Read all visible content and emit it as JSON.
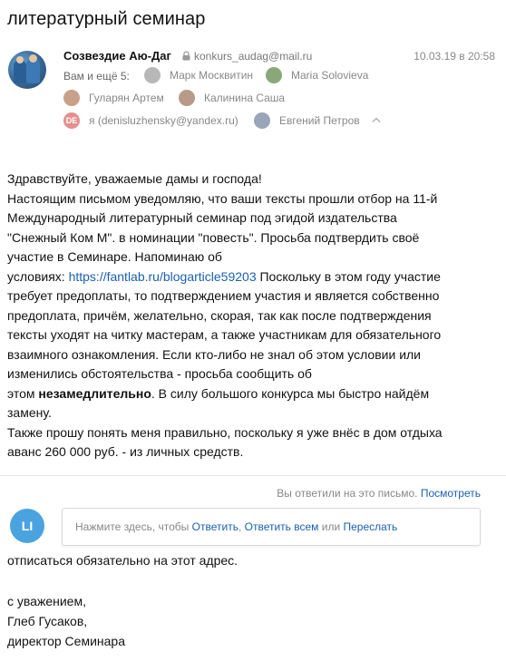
{
  "subject": "литературный семинар",
  "sender": {
    "name": "Созвездие Аю-Даг",
    "email": "konkurs_audag@mail.ru",
    "date": "10.03.19 в 20:58",
    "avatar_icon": "sender-photo-avatar"
  },
  "recipients": {
    "label": "Вам и ещё 5:",
    "items": [
      {
        "name": "Марк Москвитин",
        "avatar_color": "#b8b8b8"
      },
      {
        "name": "Maria Solovieva",
        "avatar_color": "#8aa77a"
      },
      {
        "name": "Гуларян Артем",
        "avatar_color": "#c9a08a"
      },
      {
        "name": "Калинина Саша",
        "avatar_color": "#b79a8a"
      },
      {
        "name": "я (denisluzhensky@yandex.ru)",
        "avatar_text": "DE",
        "avatar_color": "#e58f8f"
      },
      {
        "name": "Евгений Петров",
        "avatar_color": "#9aa6b8"
      }
    ]
  },
  "body": {
    "greeting": "Здравствуйте, уважаемые дамы и господа!",
    "p1_line1": "Настоящим письмом уведомляю, что ваши тексты прошли отбор на 11-й",
    "p1_line2": "Международный литературный семинар под эгидой издательства",
    "p1_line3": "\"Снежный Ком М\". в номинации \"повесть\". Просьба подтвердить своё",
    "p1_line4": "участие в Семинаре. Напоминаю об",
    "p1_line5_pre": "условиях: ",
    "link": "https://fantlab.ru/blogarticle59203",
    "p1_line5_post": " Поскольку в этом году участие",
    "p1_line6": "требует предоплаты, то подтверждением участия и является собственно",
    "p1_line7": "предоплата, причём, желательно, скорая, так как после подтверждения",
    "p1_line8": "тексты уходят на читку мастерам, а также участникам для обязательного",
    "p1_line9": "взаимного ознакомления. Если кто-либо не знал об этом условии или",
    "p1_line10": "изменились обстоятельства - просьба сообщить об",
    "p1_line11_pre": "этом ",
    "p1_line11_bold": "незамедлительно",
    "p1_line11_post": ". В силу большого конкурса мы быстро найдём",
    "p1_line12": "замену.",
    "p2_line1": "Также прошу понять меня правильно, поскольку я уже внёс в дом отдыха",
    "p2_line2": "аванс 260 000 руб. - из личных средств."
  },
  "replied_notice": {
    "text": "Вы ответили на это письмо.",
    "link": "Посмотреть"
  },
  "reply_box": {
    "avatar_text": "LI",
    "prefix": "Нажмите здесь, чтобы ",
    "reply": "Ответить",
    "sep": ", ",
    "reply_all": "Ответить всем",
    "or": " или ",
    "forward": "Переслать"
  },
  "tail": {
    "line1": "отписаться обязательно на этот адрес.",
    "line2": "с уважением,",
    "line3": "Глеб Гусаков,",
    "line4": "директор Семинара"
  },
  "colors": {
    "link": "#1a5fb4",
    "reply_avatar": "#4aa3df",
    "me_avatar": "#e58f8f"
  }
}
